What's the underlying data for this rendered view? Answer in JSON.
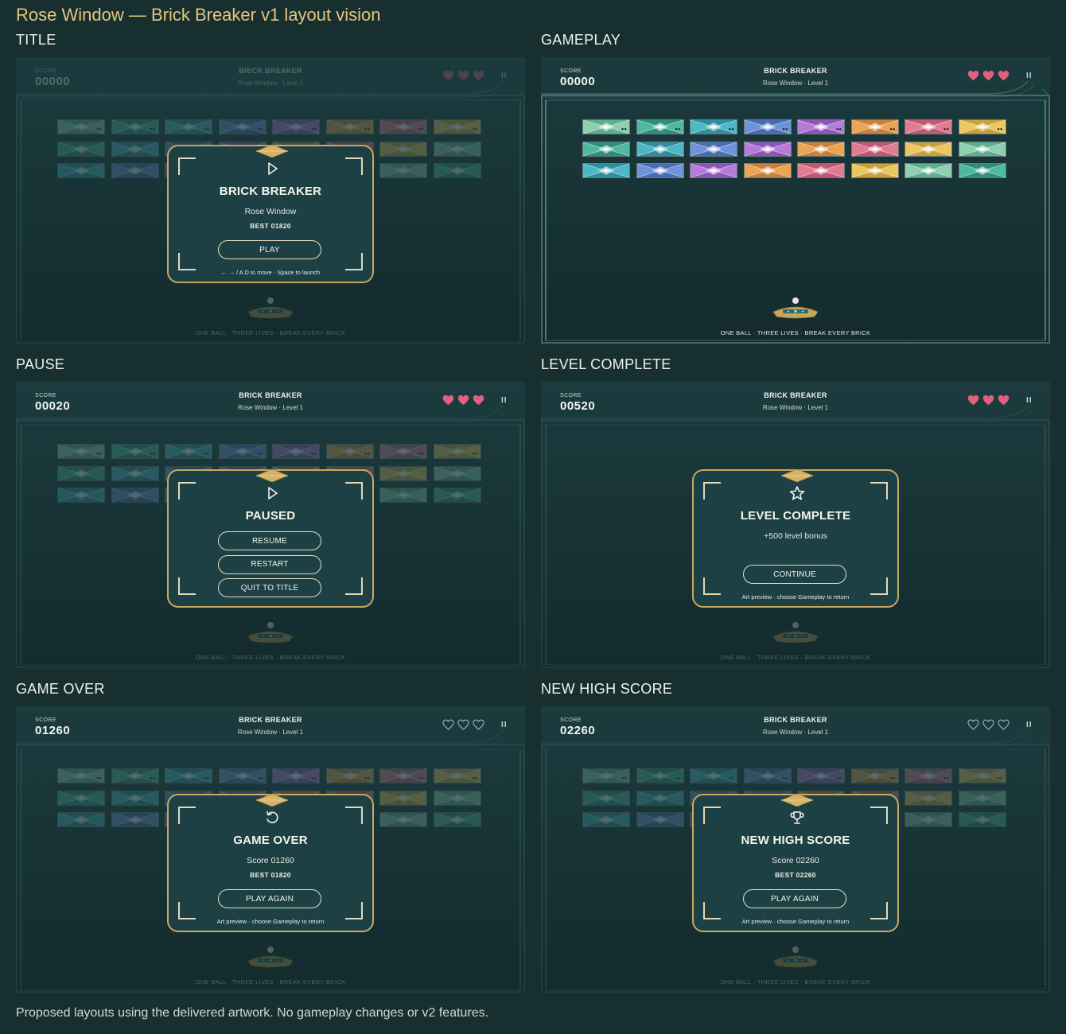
{
  "page_title": "Rose Window — Brick Breaker v1 layout vision",
  "footer": "Proposed layouts using the delivered artwork. No gameplay changes or v2 features.",
  "colors": {
    "gold": "#c8a760",
    "heart_full": "#e0607e",
    "heart_empty": "#9fc6cf",
    "screen_bg": "#173235"
  },
  "brick_palettes": {
    "mint": [
      "#8fcfae",
      "#5fae8e"
    ],
    "green": [
      "#4fb9a0",
      "#2f8d7c"
    ],
    "teal": [
      "#4cb8c6",
      "#2e8e9d"
    ],
    "blue": [
      "#6f93d8",
      "#4a6cb5"
    ],
    "violet": [
      "#b67ad8",
      "#8c55b8"
    ],
    "orange": [
      "#eba453",
      "#c9803a"
    ],
    "pink": [
      "#e07c92",
      "#c05873"
    ],
    "yellow": [
      "#ecc660",
      "#c9a03d"
    ]
  },
  "brick_rows": [
    [
      "mint",
      "green",
      "teal",
      "blue",
      "violet",
      "orange",
      "pink",
      "yellow"
    ],
    [
      "green",
      "teal",
      "blue",
      "violet",
      "orange",
      "pink",
      "yellow",
      "mint"
    ],
    [
      "teal",
      "blue",
      "violet",
      "orange",
      "pink",
      "yellow",
      "mint",
      "green"
    ]
  ],
  "hud": {
    "score_label": "SCORE",
    "game_title": "BRICK BREAKER",
    "subtitle": "Rose Window · Level 1",
    "pause_icon": "pause-icon",
    "pause_glyph": "II"
  },
  "tagline": "ONE BALL · THREE LIVES · BREAK EVERY BRICK",
  "panels": [
    {
      "label": "TITLE",
      "score": "00000",
      "hearts": [
        "full",
        "full",
        "full"
      ],
      "hud_faded": true,
      "dimmed": true,
      "dialog": {
        "icon": "play-icon",
        "title": "BRICK BREAKER",
        "line1": "Rose Window",
        "line2": "BEST  01820",
        "buttons": [
          "PLAY"
        ],
        "hint": "← → / A D to move · Space to launch"
      }
    },
    {
      "label": "GAMEPLAY",
      "score": "00000",
      "hearts": [
        "full",
        "full",
        "full"
      ],
      "hud_faded": false,
      "dimmed": false,
      "dialog": null
    },
    {
      "label": "PAUSE",
      "score": "00020",
      "hearts": [
        "full",
        "full",
        "full"
      ],
      "hud_faded": false,
      "dimmed": true,
      "dialog": {
        "icon": "play-icon",
        "title": "PAUSED",
        "line1": "",
        "line2": "",
        "buttons": [
          "RESUME",
          "RESTART",
          "QUIT TO TITLE"
        ],
        "hint": ""
      }
    },
    {
      "label": "LEVEL COMPLETE",
      "score": "00520",
      "hearts": [
        "full",
        "full",
        "full"
      ],
      "hud_faded": false,
      "dimmed": true,
      "hide_bricks": true,
      "dialog": {
        "icon": "star-icon",
        "title": "LEVEL COMPLETE",
        "line1": "+500 level bonus",
        "line2": "",
        "buttons": [
          "CONTINUE"
        ],
        "hint": "Art preview · choose Gameplay to return"
      }
    },
    {
      "label": "GAME OVER",
      "score": "01260",
      "hearts": [
        "empty",
        "empty",
        "empty"
      ],
      "hud_faded": false,
      "dimmed": true,
      "dialog": {
        "icon": "restart-icon",
        "title": "GAME OVER",
        "line1": "Score  01260",
        "line2": "BEST  01820",
        "buttons": [
          "PLAY AGAIN"
        ],
        "hint": "Art preview · choose Gameplay to return"
      }
    },
    {
      "label": "NEW HIGH SCORE",
      "score": "02260",
      "hearts": [
        "empty",
        "empty",
        "empty"
      ],
      "hud_faded": false,
      "dimmed": true,
      "dialog": {
        "icon": "trophy-icon",
        "title": "NEW HIGH SCORE",
        "line1": "Score  02260",
        "line2": "BEST  02260",
        "buttons": [
          "PLAY AGAIN"
        ],
        "hint": "Art preview · choose Gameplay to return"
      }
    }
  ]
}
